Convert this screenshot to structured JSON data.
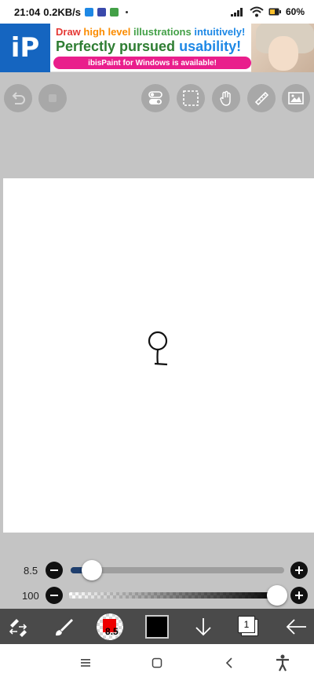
{
  "status_bar": {
    "time": "21:04",
    "speed": "0.2KB/s",
    "battery": "60%",
    "icons": [
      "chat-icon",
      "notification-icon",
      "app-icon",
      "dot-icon",
      "signal-icon",
      "wifi-icon",
      "battery-icon"
    ]
  },
  "ad": {
    "logo_text": "iP",
    "line1": [
      "Draw",
      "high level",
      "illustrations",
      "intuitively!"
    ],
    "line2_a": "Perfectly pursued",
    "line2_b": "usability!",
    "bar_text": "ibisPaint for Windows is available!"
  },
  "top_toolbar": {
    "icons": [
      "undo-icon",
      "redo-icon",
      "toggle-icon",
      "selection-icon",
      "hand-icon",
      "ruler-icon",
      "image-icon"
    ]
  },
  "sliders": {
    "size_value": "8.5",
    "size_fraction": 0.1,
    "opacity_value": "100",
    "opacity_fraction": 1.0
  },
  "bottom_toolbar": {
    "brush_size": "8.5",
    "layer_count": "1",
    "brush_color": "#ee0000",
    "current_color": "#000000",
    "icons": [
      "tool-swap-icon",
      "brush-icon",
      "brush-preview",
      "color-swatch",
      "arrow-down-icon",
      "layers-icon",
      "back-arrow-icon"
    ]
  },
  "nav_bar": {
    "icons": [
      "menu-icon",
      "home-icon",
      "back-icon",
      "accessibility-icon"
    ]
  },
  "colors": {
    "background": "#c4c4c4",
    "toolbar_dark": "#4a4a4a",
    "slider_fill": "#1f3f6e",
    "ad_blue": "#1565c0",
    "ad_pink": "#e91e8c"
  }
}
